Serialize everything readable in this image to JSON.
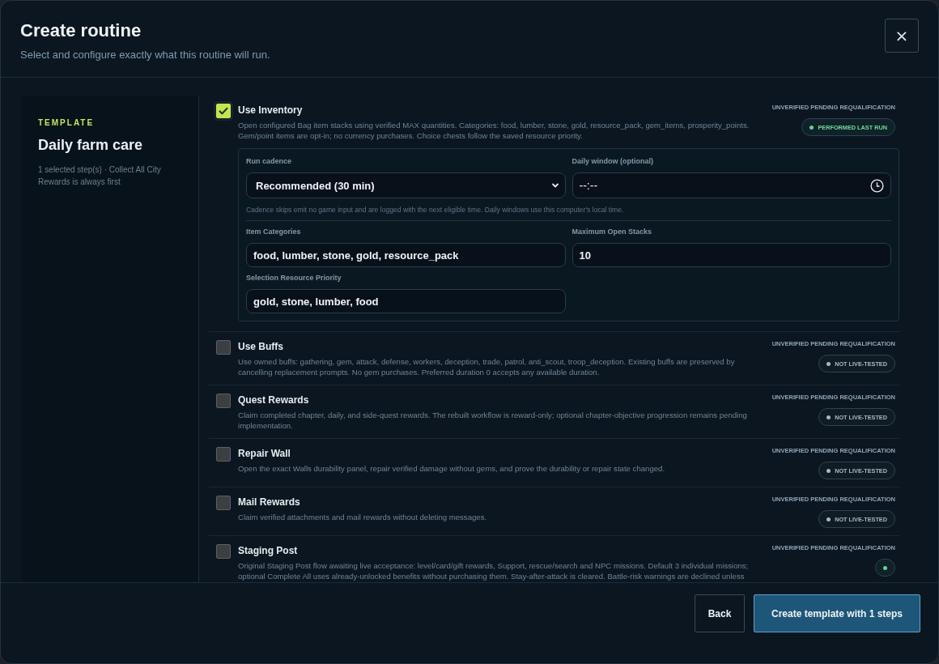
{
  "dialog": {
    "title": "Create routine",
    "subtitle": "Select and configure exactly what this routine will run.",
    "close": "×"
  },
  "template": {
    "eyebrow": "TEMPLATE",
    "name": "Daily farm care",
    "summary": "1 selected step(s) · Collect All City Rewards is always first"
  },
  "steps": [
    {
      "title": "Use Inventory",
      "checked": true,
      "description": "Open configured Bag item stacks using verified MAX quantities. Categories: food, lumber, stone, gold, resource_pack, gem_items, prosperity_points. Gem/point items are opt-in; no currency purchases. Choice chests follow the saved resource priority.",
      "tag": "UNVERIFIED PENDING REQUALIFICATION",
      "badge": {
        "label": "PERFORMED LAST RUN",
        "kind": "performed"
      },
      "config": {
        "sections": [
          {
            "fields": [
              {
                "label": "Run cadence",
                "kind": "select",
                "value": "Recommended (30 min)"
              },
              {
                "label": "Daily window (optional)",
                "kind": "time",
                "placeholder": "--:--"
              }
            ],
            "hint": "Cadence skips emit no game input and are logged with the next eligible time. Daily windows use this computer's local time."
          },
          {
            "fields": [
              {
                "label": "Item Categories",
                "kind": "text",
                "value": "food, lumber, stone, gold, resource_pack"
              },
              {
                "label": "Maximum Open Stacks",
                "kind": "text",
                "value": "10"
              },
              {
                "label": "Selection Resource Priority",
                "kind": "text",
                "value": "gold, stone, lumber, food"
              }
            ]
          }
        ]
      }
    },
    {
      "title": "Use Buffs",
      "checked": false,
      "description": "Use owned buffs: gathering, gem, attack, defense, workers, deception, trade, patrol, anti_scout, troop_deception. Existing buffs are preserved by cancelling replacement prompts. No gem purchases. Preferred duration 0 accepts any available duration.",
      "tag": "UNVERIFIED PENDING REQUALIFICATION",
      "badge": {
        "label": "NOT LIVE-TESTED",
        "kind": "untested"
      }
    },
    {
      "title": "Quest Rewards",
      "checked": false,
      "description": "Claim completed chapter, daily, and side-quest rewards. The rebuilt workflow is reward-only; optional chapter-objective progression remains pending implementation.",
      "tag": "UNVERIFIED PENDING REQUALIFICATION",
      "badge": {
        "label": "NOT LIVE-TESTED",
        "kind": "untested"
      }
    },
    {
      "title": "Repair Wall",
      "checked": false,
      "description": "Open the exact Walls durability panel, repair verified damage without gems, and prove the durability or repair state changed.",
      "tag": "UNVERIFIED PENDING REQUALIFICATION",
      "badge": {
        "label": "NOT LIVE-TESTED",
        "kind": "untested"
      }
    },
    {
      "title": "Mail Rewards",
      "checked": false,
      "description": "Claim verified attachments and mail rewards without deleting messages.",
      "tag": "UNVERIFIED PENDING REQUALIFICATION",
      "badge": {
        "label": "NOT LIVE-TESTED",
        "kind": "untested"
      }
    },
    {
      "title": "Staging Post",
      "checked": false,
      "description": "Original Staging Post flow awaiting live acceptance: level/card/gift rewards, Support, rescue/search and NPC missions. Default 3 individual missions; optional Complete All uses already-unlocked benefits without purchasing them. Stay-after-attack is cleared. Battle-risk warnings are declined unless",
      "tag": "UNVERIFIED PENDING REQUALIFICATION",
      "badge": {
        "kind": "performed"
      }
    }
  ],
  "footer": {
    "buttons": [
      {
        "label": "Back",
        "kind": "secondary"
      },
      {
        "label": "Create template with 1 steps",
        "kind": "primary"
      }
    ]
  }
}
